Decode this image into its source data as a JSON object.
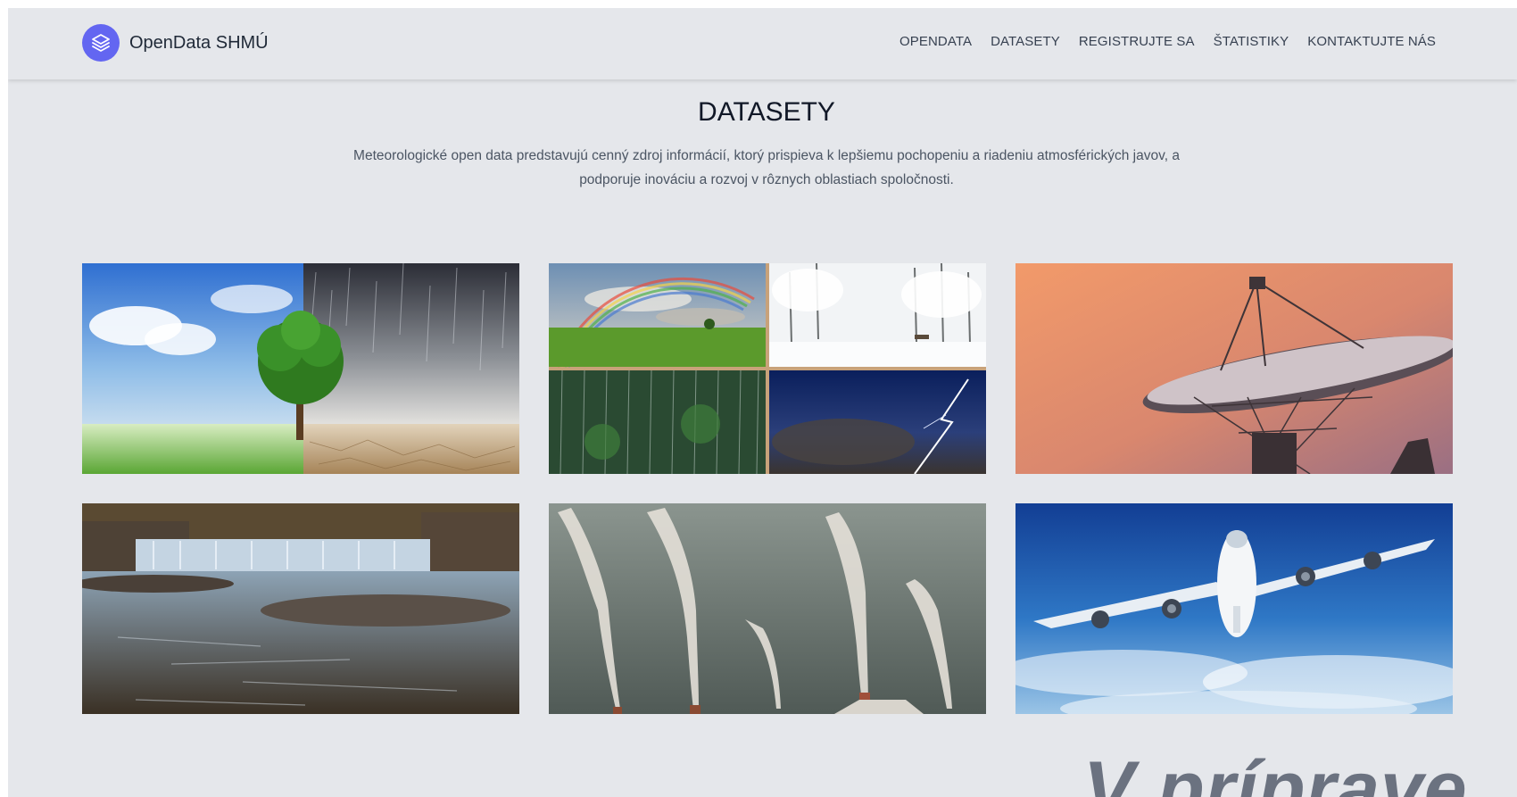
{
  "header": {
    "brand_name": "OpenData SHMÚ",
    "logo_icon": "layers-icon",
    "accent_color": "#6366f1",
    "nav": [
      {
        "label": "OPENDATA"
      },
      {
        "label": "DATASETY"
      },
      {
        "label": "REGISTRUJTE SA"
      },
      {
        "label": "ŠTATISTIKY"
      },
      {
        "label": "KONTAKTUJTE NÁS"
      }
    ]
  },
  "main": {
    "title": "DATASETY",
    "intro_line1": "Meteorologické open data predstavujú cenný zdroj informácií, ktorý prispieva k lepšiemu pochopeniu a riadeniu atmosférických javov, a",
    "intro_line2": "podporuje inováciu a rozvoj v rôznych oblastiach spoločnosti."
  },
  "banner": {
    "text": "V príprave"
  }
}
